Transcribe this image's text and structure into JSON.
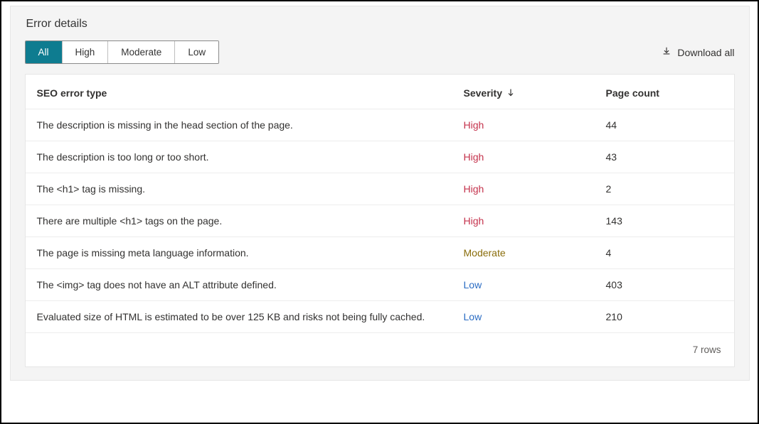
{
  "title": "Error details",
  "filters": {
    "all": {
      "label": "All",
      "active": true
    },
    "high": {
      "label": "High",
      "active": false
    },
    "moderate": {
      "label": "Moderate",
      "active": false
    },
    "low": {
      "label": "Low",
      "active": false
    }
  },
  "download_label": "Download all",
  "columns": {
    "error_type": "SEO error type",
    "severity": "Severity",
    "page_count": "Page count"
  },
  "sort": {
    "column": "severity",
    "direction": "desc"
  },
  "rows": [
    {
      "error": "The description is missing in the head section of the page.",
      "severity": "High",
      "count": "44"
    },
    {
      "error": "The description is too long or too short.",
      "severity": "High",
      "count": "43"
    },
    {
      "error": "The <h1> tag is missing.",
      "severity": "High",
      "count": "2"
    },
    {
      "error": "There are multiple <h1> tags on the page.",
      "severity": "High",
      "count": "143"
    },
    {
      "error": "The page is missing meta language information.",
      "severity": "Moderate",
      "count": "4"
    },
    {
      "error": "The <img> tag does not have an ALT attribute defined.",
      "severity": "Low",
      "count": "403"
    },
    {
      "error": "Evaluated size of HTML is estimated to be over 125 KB and risks not being fully cached.",
      "severity": "Low",
      "count": "210"
    }
  ],
  "footer": "7 rows",
  "colors": {
    "accent": "#0e7c90",
    "sev_high": "#c4314b",
    "sev_moderate": "#8a6d0b",
    "sev_low": "#2a6cc3",
    "panel_bg": "#f4f4f4"
  }
}
